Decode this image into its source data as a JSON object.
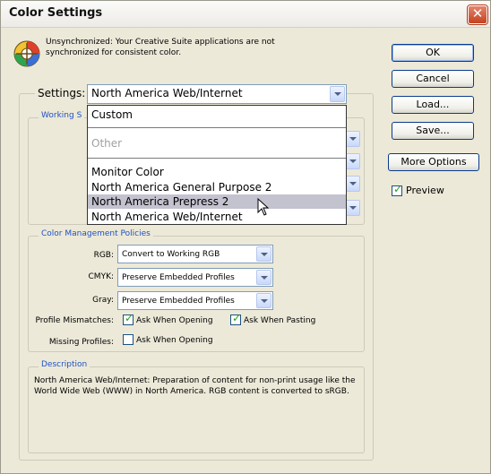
{
  "window": {
    "title": "Color Settings"
  },
  "sync": {
    "message": "Unsynchronized: Your Creative Suite applications are not synchronized for consistent color."
  },
  "buttons": {
    "ok": "OK",
    "cancel": "Cancel",
    "load": "Load...",
    "save": "Save...",
    "more_options": "More Options"
  },
  "preview": {
    "label": "Preview",
    "checked": true
  },
  "settings": {
    "label": "Settings:",
    "value": "North America Web/Internet"
  },
  "working_spaces": {
    "title": "Working S"
  },
  "dropdown": {
    "options": [
      "Custom",
      "Other",
      "Monitor Color",
      "North America General Purpose 2",
      "North America Prepress 2",
      "North America Web/Internet"
    ],
    "highlighted": "North America Prepress 2"
  },
  "policies": {
    "title": "Color Management Policies",
    "rgb_label": "RGB:",
    "rgb_value": "Convert to Working RGB",
    "cmyk_label": "CMYK:",
    "cmyk_value": "Preserve Embedded Profiles",
    "gray_label": "Gray:",
    "gray_value": "Preserve Embedded Profiles",
    "mismatch_label": "Profile Mismatches:",
    "ask_opening": "Ask When Opening",
    "ask_opening_checked": true,
    "ask_pasting": "Ask When Pasting",
    "ask_pasting_checked": true,
    "missing_label": "Missing Profiles:",
    "missing_ask_opening": "Ask When Opening",
    "missing_checked": false
  },
  "description": {
    "title": "Description",
    "text": "North America Web/Internet:  Preparation of content for non-print usage like the World Wide Web (WWW) in North America. RGB content is converted to sRGB."
  }
}
